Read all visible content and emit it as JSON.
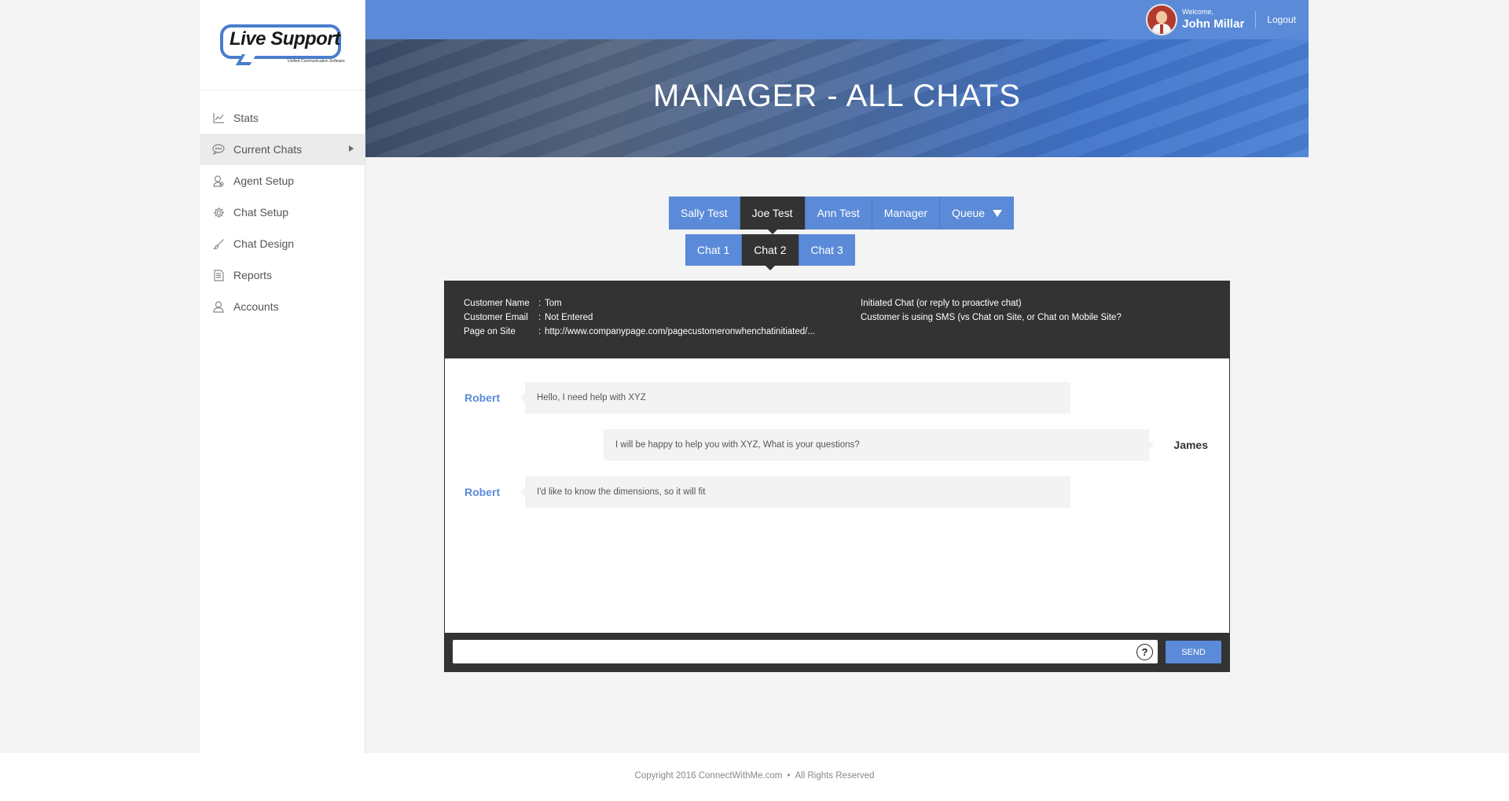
{
  "logo": {
    "name": "Live Support",
    "tagline": "Unified Communication Software"
  },
  "sidebar": {
    "items": [
      {
        "label": "Stats",
        "icon": "chart-icon"
      },
      {
        "label": "Current Chats",
        "icon": "chat-bubble-icon",
        "active": true
      },
      {
        "label": "Agent Setup",
        "icon": "agent-icon"
      },
      {
        "label": "Chat Setup",
        "icon": "gear-icon"
      },
      {
        "label": "Chat Design",
        "icon": "brush-icon"
      },
      {
        "label": "Reports",
        "icon": "document-icon"
      },
      {
        "label": "Accounts",
        "icon": "user-icon"
      }
    ]
  },
  "header": {
    "welcome": "Welcome,",
    "user_name": "John Millar",
    "logout": "Logout",
    "title": "MANAGER - ALL CHATS"
  },
  "agent_tabs": [
    {
      "label": "Sally Test",
      "active": false
    },
    {
      "label": "Joe Test",
      "active": true
    },
    {
      "label": "Ann Test",
      "active": false
    },
    {
      "label": "Manager",
      "active": false
    },
    {
      "label": "Queue",
      "active": false,
      "dropdown": true
    }
  ],
  "chat_tabs": [
    {
      "label": "Chat 1",
      "active": false
    },
    {
      "label": "Chat 2",
      "active": true
    },
    {
      "label": "Chat 3",
      "active": false
    }
  ],
  "customer_info": {
    "name_label": "Customer Name",
    "name_value": "Tom",
    "email_label": "Customer Email",
    "email_value": "Not Entered",
    "page_label": "Page on Site",
    "page_value": "http://www.companypage.com/pagecustomeronwhenchatinitiated/...",
    "separator": ":",
    "note_1": "Initiated Chat (or reply to proactive chat)",
    "note_2": "Customer is using SMS (vs Chat on Site, or Chat on Mobile Site?"
  },
  "messages": [
    {
      "sender": "Robert",
      "side": "customer",
      "text": "Hello, I need help with XYZ"
    },
    {
      "sender": "James",
      "side": "agent",
      "text": "I will be happy to help you with XYZ, What is your questions?"
    },
    {
      "sender": "Robert",
      "side": "customer",
      "text": "I'd like to know the dimensions, so it will fit"
    }
  ],
  "composer": {
    "value": "",
    "placeholder": "",
    "help": "?",
    "send_label": "SEND"
  },
  "footer": {
    "copyright": "Copyright 2016 ConnectWithMe.com",
    "separator": "•",
    "rights": "All Rights Reserved"
  },
  "colors": {
    "accent": "#5b8bd8",
    "dark": "#333333",
    "background": "#f4f4f4"
  }
}
